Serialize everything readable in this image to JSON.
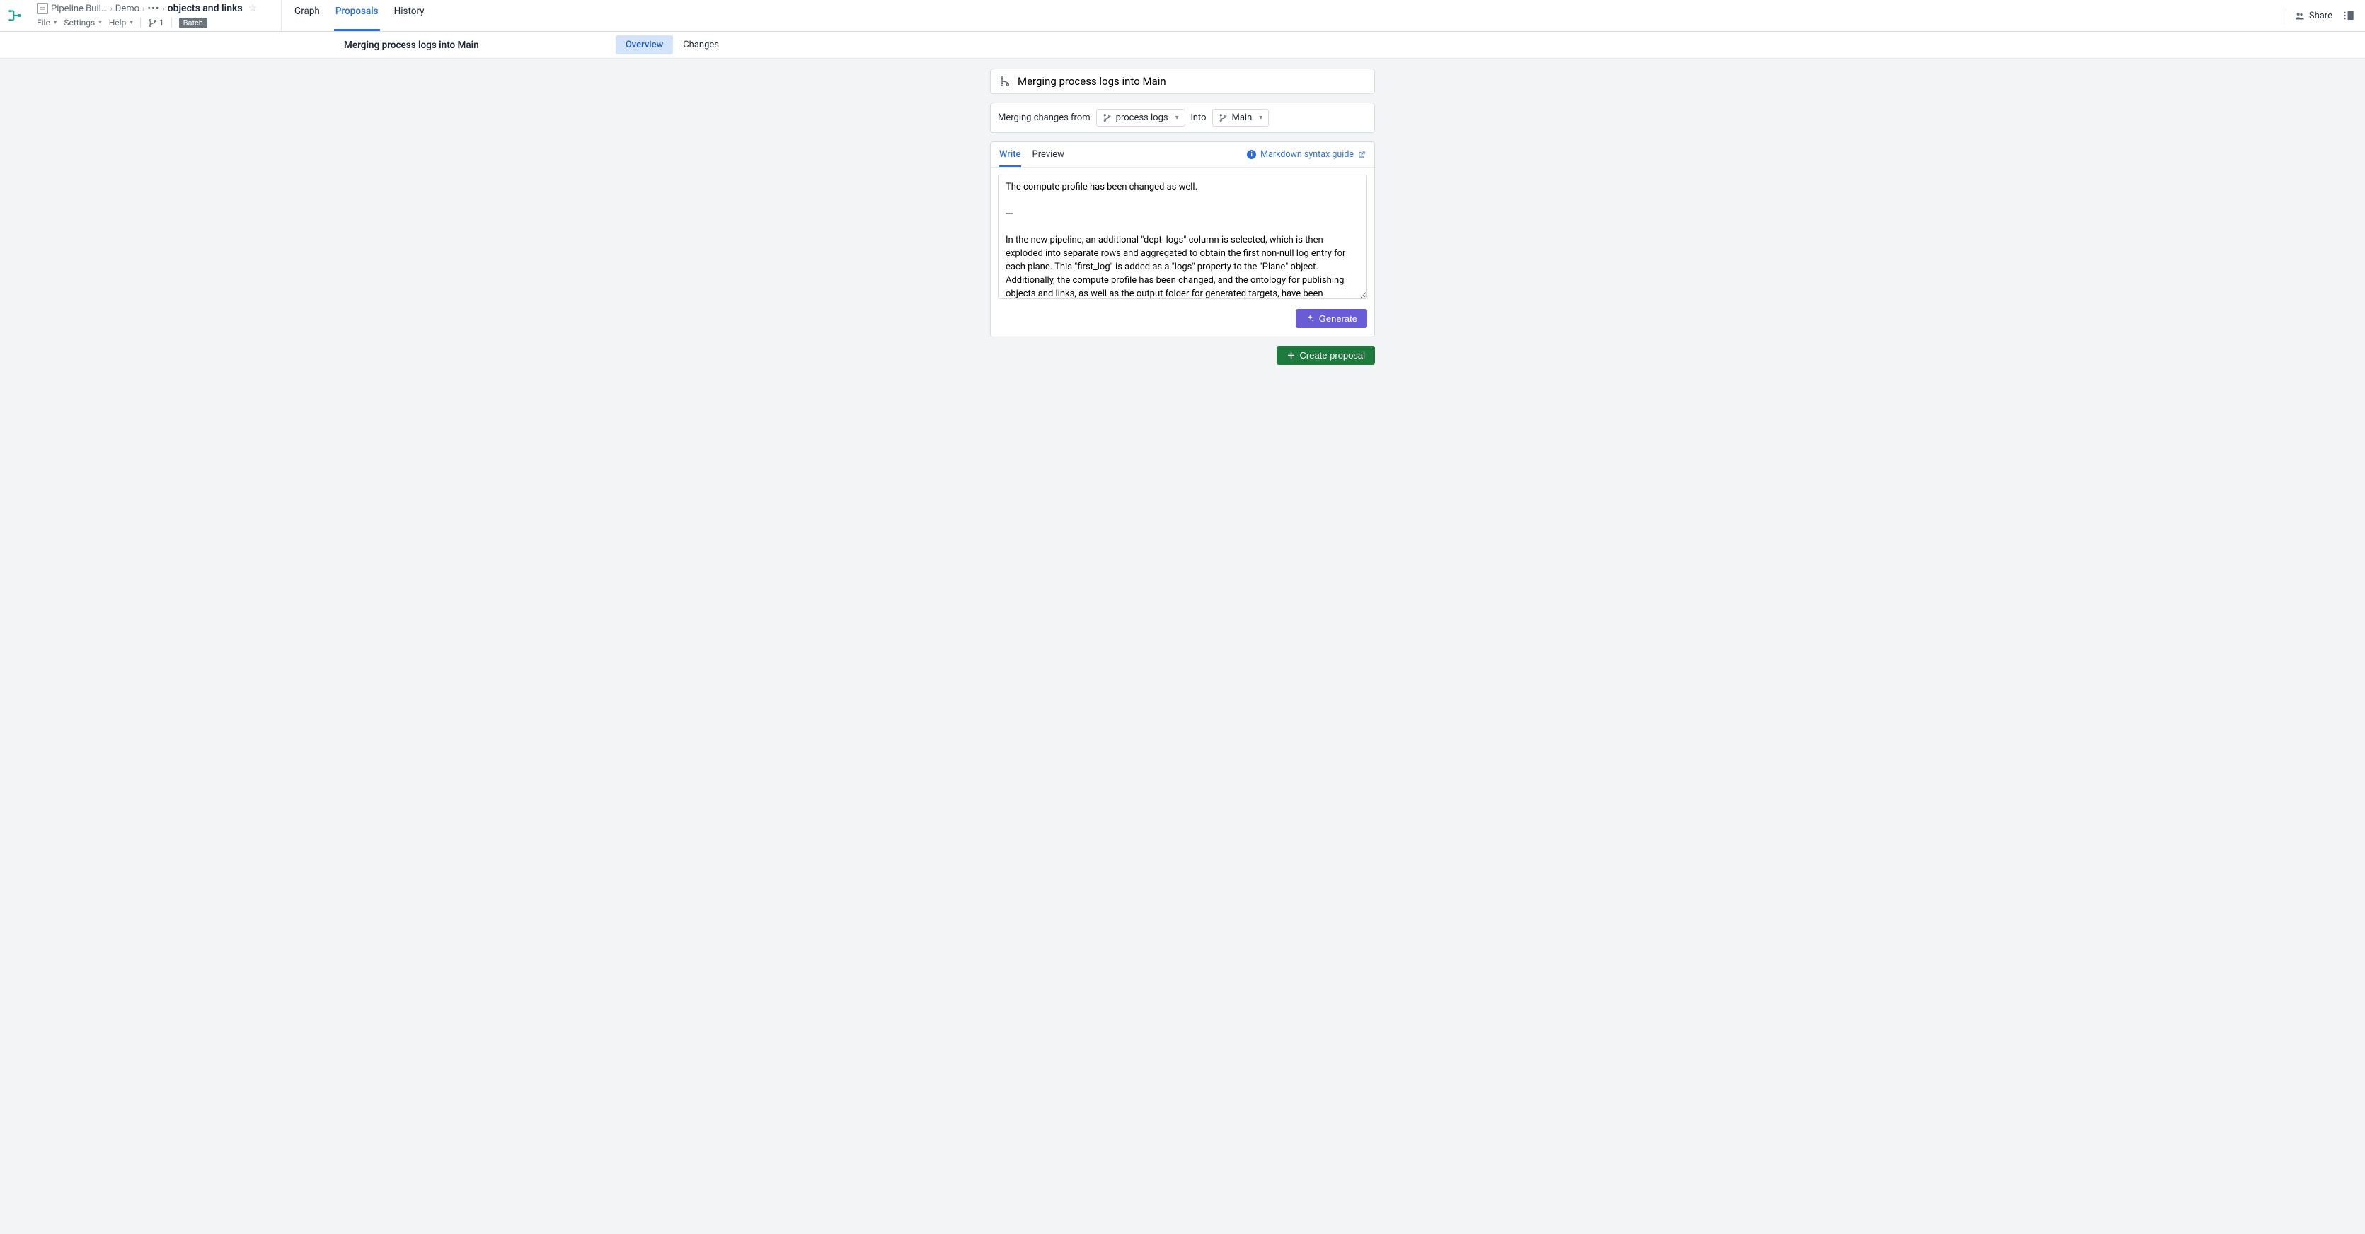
{
  "breadcrumbs": {
    "root": "Pipeline Buil…",
    "folder": "Demo",
    "current": "objects and links"
  },
  "menubar": {
    "file": "File",
    "settings": "Settings",
    "help": "Help",
    "branch_count": "1",
    "batch": "Batch"
  },
  "top_tabs": {
    "graph": "Graph",
    "proposals": "Proposals",
    "history": "History"
  },
  "topbar_right": {
    "share": "Share"
  },
  "subheader": {
    "title": "Merging process logs into Main",
    "seg_overview": "Overview",
    "seg_changes": "Changes"
  },
  "proposal_title": "Merging process logs into Main",
  "merge_row": {
    "prefix": "Merging changes from",
    "source_branch": "process logs",
    "into": "into",
    "target_branch": "Main"
  },
  "editor": {
    "tab_write": "Write",
    "tab_preview": "Preview",
    "md_guide": "Markdown syntax guide",
    "description": "The compute profile has been changed as well.\n\n---\n\nIn the new pipeline, an additional \"dept_logs\" column is selected, which is then exploded into separate rows and aggregated to obtain the first non-null log entry for each plane. This \"first_log\" is added as a \"logs\" property to the \"Plane\" object. Additionally, the compute profile has been changed, and the ontology for publishing objects and links, as well as the output folder for generated targets, have been specified.",
    "generate": "Generate"
  },
  "actions": {
    "create_proposal": "Create proposal"
  }
}
